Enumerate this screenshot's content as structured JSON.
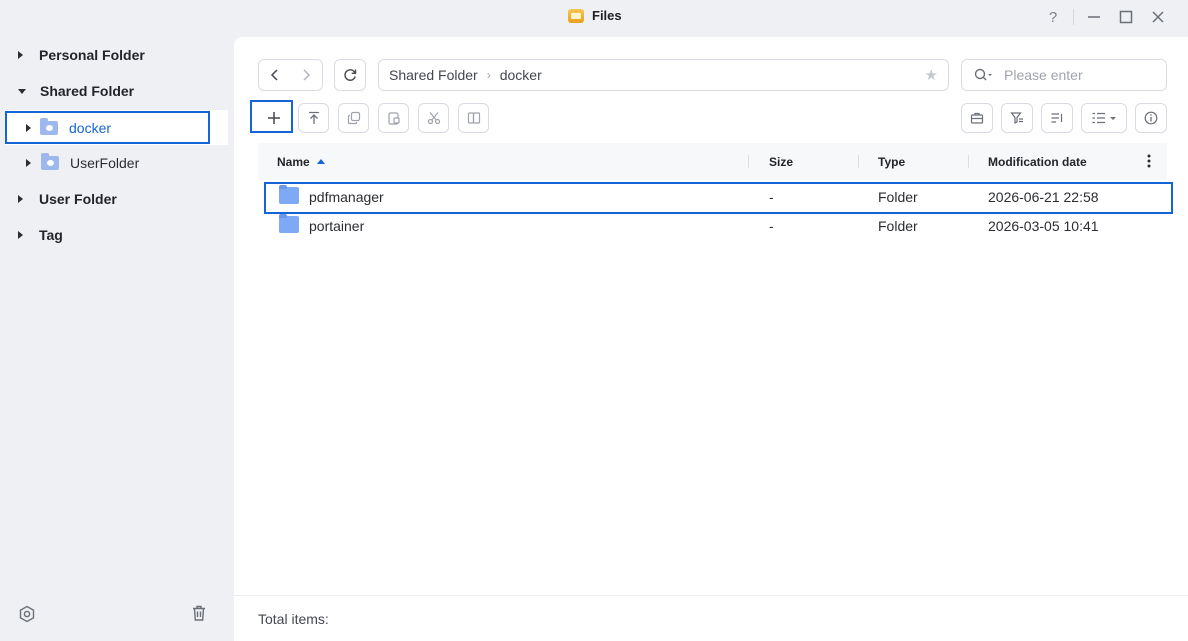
{
  "window": {
    "title": "Files",
    "controls": {
      "help": "?",
      "minimize": "—",
      "maximize": "☐",
      "close": "✕"
    }
  },
  "sidebar": {
    "items": [
      {
        "label": "Personal Folder",
        "expanded": false
      },
      {
        "label": "Shared Folder",
        "expanded": true
      },
      {
        "label": "docker",
        "selected": true
      },
      {
        "label": "UserFolder"
      },
      {
        "label": "User Folder",
        "expanded": false
      },
      {
        "label": "Tag",
        "expanded": false
      }
    ]
  },
  "toolbar": {
    "path": [
      "Shared Folder",
      "docker"
    ],
    "search_placeholder": "Please enter"
  },
  "table": {
    "columns": [
      "Name",
      "Size",
      "Type",
      "Modification date"
    ],
    "sort": {
      "column": "Name",
      "direction": "ascending"
    },
    "rows": [
      {
        "name": "pdfmanager",
        "size": "-",
        "type": "Folder",
        "modified": "2026-06-21 22:58"
      },
      {
        "name": "portainer",
        "size": "-",
        "type": "Folder",
        "modified": "2026-03-05 10:41"
      }
    ]
  },
  "footer": {
    "total_label": "Total items:"
  },
  "colors": {
    "accent": "#1565d8",
    "folder": "#7ea9f4",
    "sidebar_bg": "#eef0f4"
  }
}
